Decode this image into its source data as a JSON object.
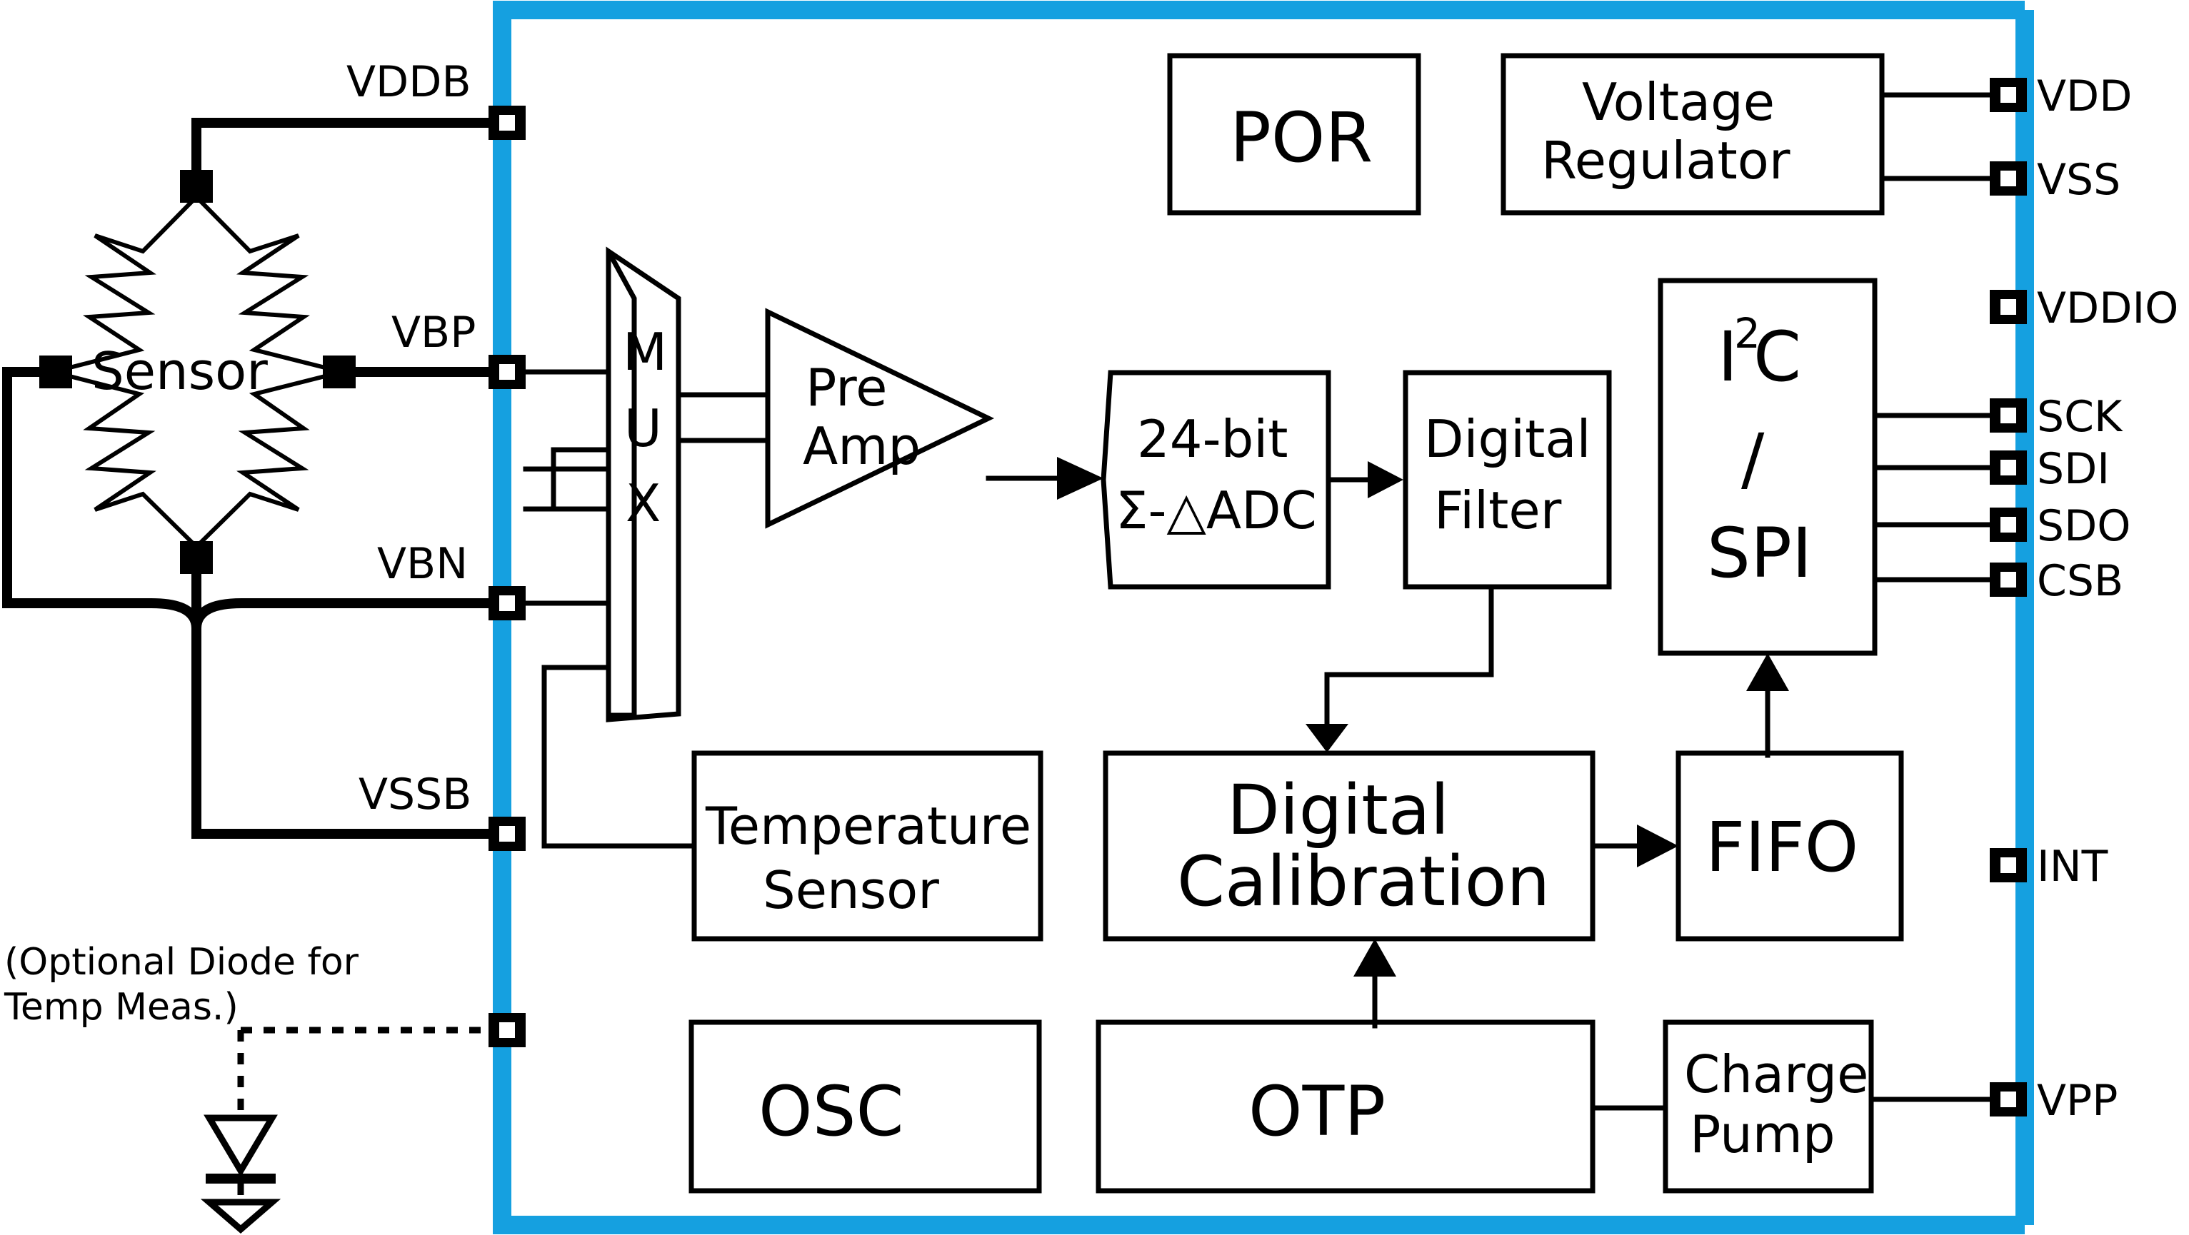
{
  "diagram": {
    "title_text": "",
    "accent_color": "#15a0e0",
    "line_color": "#000000",
    "background_color": "#ffffff"
  },
  "external": {
    "sensor_label": "Sensor",
    "optional_note_line1": "(Optional Diode for",
    "optional_note_line2": "Temp Meas.)"
  },
  "pins_left": [
    {
      "name": "VDDB"
    },
    {
      "name": "VBP"
    },
    {
      "name": "VBN"
    },
    {
      "name": "VSSB"
    }
  ],
  "pins_right": [
    {
      "name": "VDD"
    },
    {
      "name": "VSS"
    },
    {
      "name": "VDDIO"
    },
    {
      "name": "SCK"
    },
    {
      "name": "SDI"
    },
    {
      "name": "SDO"
    },
    {
      "name": "CSB"
    },
    {
      "name": "INT"
    },
    {
      "name": "VPP"
    }
  ],
  "blocks": {
    "mux": {
      "label_chars": [
        "M",
        "U",
        "X"
      ],
      "label": "MUX"
    },
    "preamp": {
      "line1": "Pre",
      "line2": "Amp"
    },
    "adc": {
      "line1": "24-bit",
      "line2": "Σ-△ADC"
    },
    "digital_filter": {
      "line1": "Digital",
      "line2": "Filter"
    },
    "por": {
      "label": "POR"
    },
    "voltage_regulator": {
      "line1": "Voltage",
      "line2": "Regulator"
    },
    "serial_interface": {
      "line1": "I",
      "sup": "2",
      "line1b": "C",
      "line2": "/",
      "line3": "SPI"
    },
    "temperature_sensor": {
      "line1": "Temperature",
      "line2": "Sensor"
    },
    "digital_calibration": {
      "line1": "Digital",
      "line2": "Calibration"
    },
    "fifo": {
      "label": "FIFO"
    },
    "osc": {
      "label": "OSC"
    },
    "otp": {
      "label": "OTP"
    },
    "charge_pump": {
      "line1": "Charge",
      "line2": "Pump"
    }
  }
}
